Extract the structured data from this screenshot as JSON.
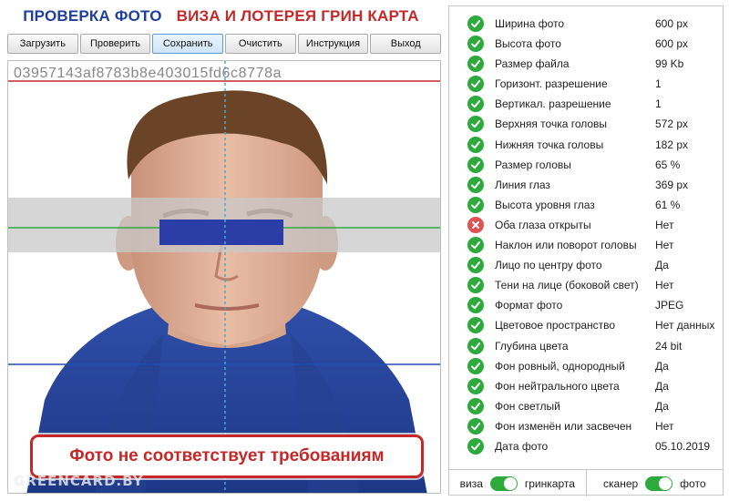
{
  "header": {
    "title_left": "ПРОВЕРКА ФОТО",
    "title_right": "ВИЗА И ЛОТЕРЕЯ ГРИН КАРТА",
    "title_left_color": "#1f3f9e",
    "title_right_color": "#c62828"
  },
  "toolbar": {
    "buttons": [
      {
        "label": "Загрузить"
      },
      {
        "label": "Проверить"
      },
      {
        "label": "Сохранить",
        "active": true
      },
      {
        "label": "Очистить"
      },
      {
        "label": "Инструкция"
      },
      {
        "label": "Выход"
      }
    ]
  },
  "photo": {
    "hash": "03957143af8783b8e403015fd6c8778a",
    "watermark": "GREENCARD.BY",
    "verdict": "Фото не соответствует требованиям",
    "verdict_color": "#c62828",
    "eye_bar_color": "#2b3ea8",
    "overlay": {
      "top_line_color": "#c62828",
      "eye_line_color": "#2eaa3d",
      "chin_line_color": "#1f4fb0",
      "center_line_color": "#4da6c9",
      "eye_band_color": "#c8c8c8"
    }
  },
  "checks": [
    {
      "label": "Ширина фото",
      "value": "600 px",
      "status": "ok"
    },
    {
      "label": "Высота фото",
      "value": "600 px",
      "status": "ok"
    },
    {
      "label": "Размер файла",
      "value": "99 Kb",
      "status": "ok"
    },
    {
      "label": "Горизонт. разрешение",
      "value": "1",
      "status": "ok"
    },
    {
      "label": "Вертикал. разрешение",
      "value": "1",
      "status": "ok"
    },
    {
      "label": "Верхняя точка головы",
      "value": "572 px",
      "status": "ok"
    },
    {
      "label": "Нижняя точка головы",
      "value": "182 px",
      "status": "ok"
    },
    {
      "label": "Размер головы",
      "value": "65 %",
      "status": "ok"
    },
    {
      "label": "Линия глаз",
      "value": "369 px",
      "status": "ok"
    },
    {
      "label": "Высота уровня глаз",
      "value": "61 %",
      "status": "ok"
    },
    {
      "label": "Оба глаза открыты",
      "value": "Нет",
      "status": "fail"
    },
    {
      "label": "Наклон или поворот головы",
      "value": "Нет",
      "status": "ok"
    },
    {
      "label": "Лицо по центру фото",
      "value": "Да",
      "status": "ok"
    },
    {
      "label": "Тени на лице (боковой свет)",
      "value": "Нет",
      "status": "ok"
    },
    {
      "label": "Формат фото",
      "value": "JPEG",
      "status": "ok"
    },
    {
      "label": "Цветовое пространство",
      "value": "Нет данных",
      "status": "ok"
    },
    {
      "label": "Глубина цвета",
      "value": "24 bit",
      "status": "ok"
    },
    {
      "label": "Фон ровный, однородный",
      "value": "Да",
      "status": "ok"
    },
    {
      "label": "Фон нейтрального цвета",
      "value": "Да",
      "status": "ok"
    },
    {
      "label": "Фон светлый",
      "value": "Да",
      "status": "ok"
    },
    {
      "label": "Фон изменён или засвечен",
      "value": "Нет",
      "status": "ok"
    },
    {
      "label": "Дата фото",
      "value": "05.10.2019",
      "status": "ok"
    }
  ],
  "status_colors": {
    "ok": "#2eaa3d",
    "fail": "#e05252"
  },
  "footer": {
    "left": {
      "label_before": "виза",
      "label_after": "гринкарта",
      "on": true
    },
    "right": {
      "label_before": "сканер",
      "label_after": "фото",
      "on": true
    }
  }
}
